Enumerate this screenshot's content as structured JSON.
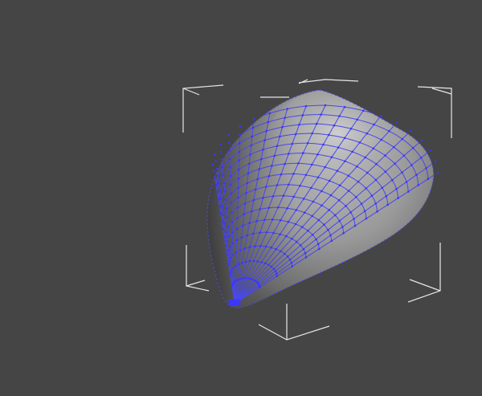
{
  "viewport": {
    "background": "#454545",
    "object": {
      "type": "subdivision-mesh",
      "shape": "teardrop / seed",
      "shading": "gray",
      "wire_color": "#4a48e8",
      "vertex_color": "#3b36ff"
    },
    "selection_bracket_color": "#e8e8e8"
  }
}
